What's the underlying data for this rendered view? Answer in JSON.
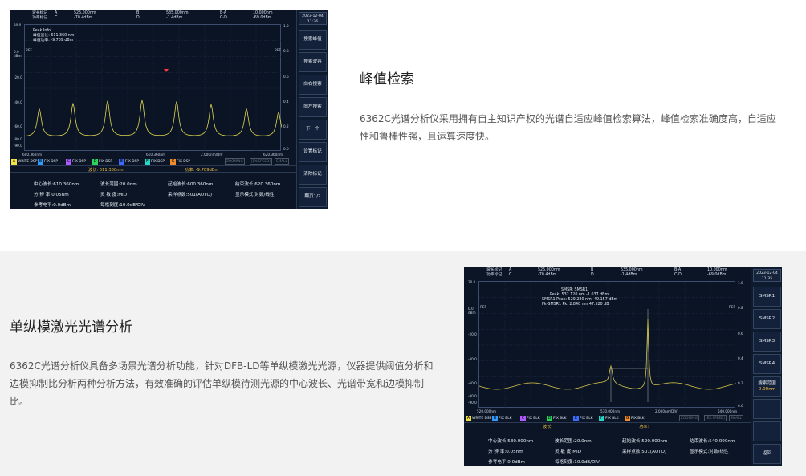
{
  "section1": {
    "title": "峰值检索",
    "description": "6362C光谱分析仪采用拥有自主知识产权的光谱自适应峰值检索算法，峰值检索准确度高，自适应性和鲁棒性强，且运算速度快。",
    "screen": {
      "header": {
        "r1": [
          "波长标记",
          "A",
          "525.000nm",
          "B",
          "535.000nm",
          "B-A",
          "10.000nm"
        ],
        "r2": [
          "功率标记",
          "C",
          "-70.4dBm",
          "D",
          "-1.4dBm",
          "C-D",
          "-69.0dBm"
        ]
      },
      "datetime": {
        "date": "2023-12-04",
        "time": "11:36"
      },
      "menu": [
        "搜索峰值",
        "搜索波谷",
        "向右搜索",
        "向左搜索",
        "下一个",
        "设置标记",
        "清除标记",
        "翻页1/2"
      ],
      "peak_info": {
        "title": "Peak Info",
        "wl_label": "峰值波长:",
        "wl": "611.360 nm",
        "pw_label": "峰值功率:",
        "pw": "-9.709 dBm"
      },
      "y_left": [
        "30.0",
        "0.0",
        "-20.0",
        "-40.0",
        "-60.0",
        "-80.0",
        "-90.0"
      ],
      "y_left_unit": "dBm",
      "y_right": [
        "1.0",
        "0.8",
        "0.6",
        "0.4",
        "0.2",
        "0.0"
      ],
      "ref_marks": [
        "REF",
        "REF"
      ],
      "x_labels": [
        "600.360nm",
        "610.360nm",
        "2.000nm/DIV",
        "620.360nm"
      ],
      "traces": [
        {
          "letter": "A",
          "name": "WRITE DSP",
          "color": "#f1e346"
        },
        {
          "letter": "B",
          "name": "FIX DSP",
          "color": "#2f9bff"
        },
        {
          "letter": "C",
          "name": "FIX DSP",
          "color": "#b05bff"
        },
        {
          "letter": "D",
          "name": "FIX DSP",
          "color": "#2bd35a"
        },
        {
          "letter": "E",
          "name": "FIX DSP",
          "color": "#3c6cff"
        },
        {
          "letter": "F",
          "name": "FIX DSP",
          "color": "#28d6c8"
        },
        {
          "letter": "G",
          "name": "FIX DSP",
          "color": "#f08a2c"
        }
      ],
      "grey_buttons": [
        "ZOOMING",
        "[EX:SPEED]",
        "SMALL"
      ],
      "readout": {
        "wl": "波长: 611.360nm",
        "pw": "功率: -9.709dBm"
      },
      "params": {
        "center": "中心波长:610.360nm",
        "span": "波长范围:20.0nm",
        "start": "起始波长:600.360nm",
        "stop": "结束波长:620.360nm",
        "res": "分 辨 率:0.05nm",
        "sens": "灵 敏 度:MID",
        "samp": "采样点数:501(AUTO)",
        "disp": "显示模式:对数/线性",
        "ref": "参考电平:0.0dBm",
        "scale": "每格刻度:10.0dB/DIV"
      },
      "colors": {
        "trace": "#e0d850",
        "marker": "#ff3b3b"
      }
    }
  },
  "section2": {
    "title": "单纵模激光光谱分析",
    "description": "6362C光谱分析仪具备多场景光谱分析功能，针对DFB-LD等单纵模激光光源，仪器提供阈值分析和边模抑制比分析两种分析方法，有效准确的评估单纵模待测光源的中心波长、光谱带宽和边模抑制比。",
    "screen": {
      "header": {
        "r1": [
          "波长标记",
          "A",
          "525.000nm",
          "B",
          "535.000nm",
          "B-A",
          "10.000nm"
        ],
        "r2": [
          "功率标记",
          "C",
          "-70.4dBm",
          "D",
          "-1.4dBm",
          "C-D",
          "-69.0dBm"
        ]
      },
      "datetime": {
        "date": "2023-12-04",
        "time": "11:35"
      },
      "menu": [
        "SMSR1",
        "SMSR2",
        "SMSR3",
        "SMSR4",
        "搜索范围",
        "",
        "",
        "返回"
      ],
      "menu_sub": "0.00nm",
      "smsr_info": {
        "title": "SMSR: SMSR1",
        "l1": "Peak: 532.120 nm -1.637 dBm",
        "l2": "SMSR1 Peak: 529.280 nm -49.157 dBm",
        "l3": "Pk-SMSR1 Pk: 2.840 nm 47.520 dB"
      },
      "y_left": [
        "20.0",
        "0.0",
        "-20.0",
        "-40.0",
        "-60.0",
        "-80.0",
        "-90.0"
      ],
      "y_left_unit": "dBm",
      "y_right": [
        "1.0",
        "0.8",
        "0.6",
        "0.4",
        "0.2",
        "0.0"
      ],
      "ref_marks": [
        "REF",
        "REF"
      ],
      "x_labels": [
        "520.000nm",
        "530.000nm",
        "2.000nm/DIV",
        "540.000nm"
      ],
      "traces": [
        {
          "letter": "A",
          "name": "WRITE DSP",
          "color": "#f1e346"
        },
        {
          "letter": "B",
          "name": "FIX BLK",
          "color": "#2f9bff"
        },
        {
          "letter": "C",
          "name": "FIX BLK",
          "color": "#b05bff"
        },
        {
          "letter": "D",
          "name": "FIX BLK",
          "color": "#2bd35a"
        },
        {
          "letter": "E",
          "name": "FIX BLK",
          "color": "#3c6cff"
        },
        {
          "letter": "F",
          "name": "FIX BLK",
          "color": "#28d6c8"
        },
        {
          "letter": "G",
          "name": "FIX BLK",
          "color": "#f08a2c"
        }
      ],
      "grey_buttons": [
        "ZOOMING",
        "[EX:SPEED]",
        "SMALL"
      ],
      "readout": {
        "wl": "波长:",
        "pw": "功率:"
      },
      "params": {
        "center": "中心波长:530.000nm",
        "span": "波长范围:20.0nm",
        "start": "起始波长:520.000nm",
        "stop": "结束波长:540.000nm",
        "res": "分 辨 率:0.05nm",
        "sens": "灵 敏 度:MID",
        "samp": "采样点数:501(AUTO)",
        "disp": "显示模式:对数/线性",
        "ref": "参考电平:0.0dBm",
        "scale": "每格刻度:10.0dB/DIV"
      },
      "colors": {
        "trace": "#d8c64a",
        "marker": "#e0e0e0"
      }
    }
  }
}
